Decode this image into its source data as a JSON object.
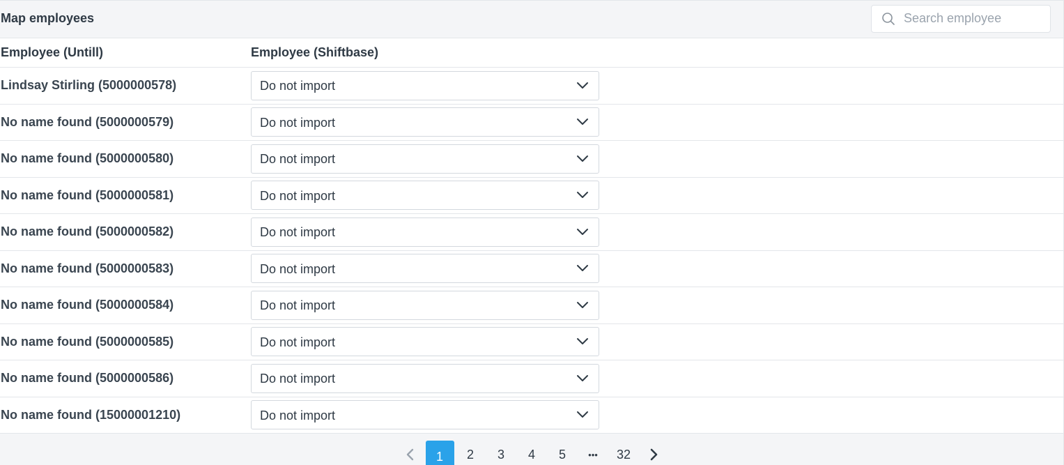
{
  "header": {
    "title": "Map employees",
    "search_placeholder": "Search employee"
  },
  "columns": {
    "untill": "Employee (Untill)",
    "shiftbase": "Employee (Shiftbase)"
  },
  "rows": [
    {
      "name": "Lindsay Stirling (5000000578)",
      "selection": "Do not import"
    },
    {
      "name": "No name found (5000000579)",
      "selection": "Do not import"
    },
    {
      "name": "No name found (5000000580)",
      "selection": "Do not import"
    },
    {
      "name": "No name found (5000000581)",
      "selection": "Do not import"
    },
    {
      "name": "No name found (5000000582)",
      "selection": "Do not import"
    },
    {
      "name": "No name found (5000000583)",
      "selection": "Do not import"
    },
    {
      "name": "No name found (5000000584)",
      "selection": "Do not import"
    },
    {
      "name": "No name found (5000000585)",
      "selection": "Do not import"
    },
    {
      "name": "No name found (5000000586)",
      "selection": "Do not import"
    },
    {
      "name": "No name found (15000001210)",
      "selection": "Do not import"
    }
  ],
  "pagination": {
    "pages": [
      "1",
      "2",
      "3",
      "4",
      "5",
      "•••",
      "32"
    ],
    "active": "1",
    "prev_icon": "chevron-left-icon",
    "next_icon": "chevron-right-icon"
  },
  "colors": {
    "accent": "#2aa2e9",
    "header_bg": "#f4f5f7",
    "text": "#2f3a45"
  }
}
